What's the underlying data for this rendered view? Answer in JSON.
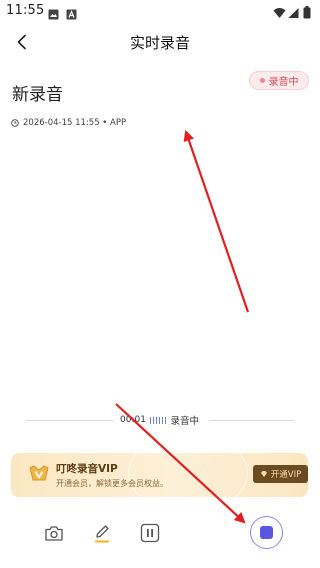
{
  "status_bar": {
    "time": "11:55",
    "left_icons": [
      "image-icon",
      "text-a-icon"
    ],
    "right_icons": [
      "wifi-icon",
      "signal-icon",
      "battery-icon"
    ]
  },
  "header": {
    "title": "实时录音",
    "back_icon": "chevron-left-icon"
  },
  "note": {
    "title": "新录音",
    "status_badge": "录音中",
    "meta": "2026-04-15 11:55 • APP",
    "meta_icon": "clock-icon"
  },
  "timeline": {
    "elapsed": "00:01",
    "status": "录音中"
  },
  "vip_banner": {
    "title": "叮咚录音VIP",
    "subtitle": "开通会员，解锁更多会员权益。",
    "button_label": "开通VIP"
  },
  "toolbar": {
    "items": [
      {
        "name": "camera",
        "icon": "camera-icon"
      },
      {
        "name": "edit",
        "icon": "pencil-icon"
      },
      {
        "name": "pause",
        "icon": "pause-icon"
      },
      {
        "name": "stop",
        "icon": "stop-icon"
      }
    ]
  },
  "colors": {
    "accent": "#5a55e0",
    "recording_red": "#e04a4f",
    "vip_brown": "#6b4b1f",
    "vip_gold": "#fbe7c2",
    "annotation_arrow": "#e02020"
  }
}
